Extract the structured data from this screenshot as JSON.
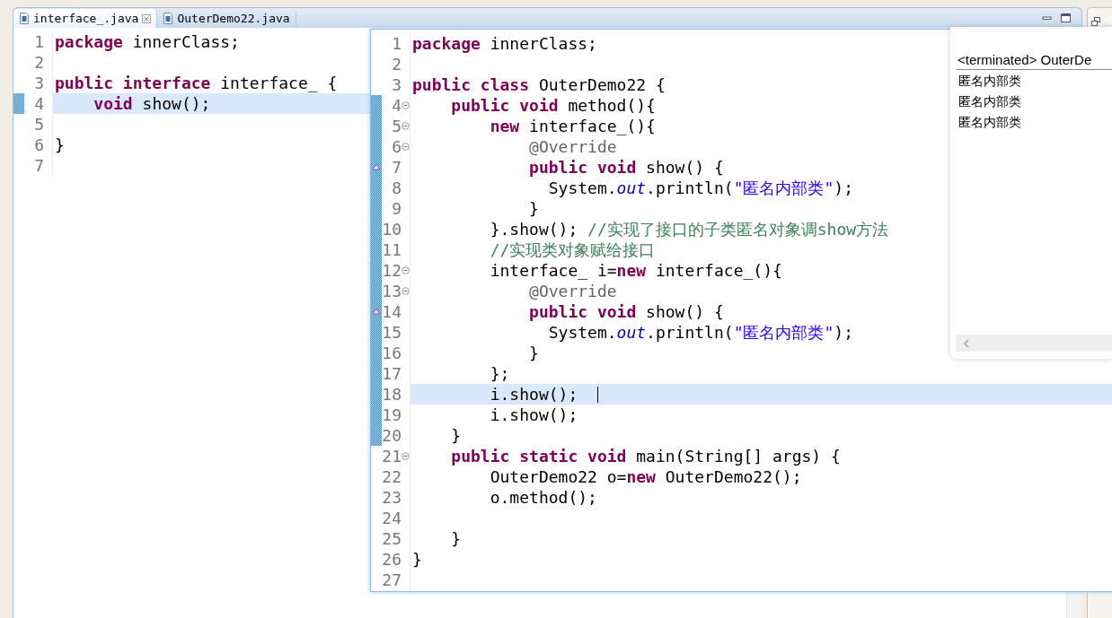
{
  "tabs": [
    {
      "label": "interface_.java",
      "selected": true,
      "closable": true
    },
    {
      "label": "OuterDemo22.java",
      "selected": false,
      "closable": false
    }
  ],
  "editor": {
    "lines": [
      {
        "number": "1",
        "tokens": [
          {
            "kind": "keyword",
            "text": "package"
          },
          {
            "kind": "plain",
            "text": " innerClass;"
          }
        ],
        "current": false,
        "marked": false
      },
      {
        "number": "2",
        "current": false,
        "marked": false
      },
      {
        "number": "3",
        "tokens": [
          {
            "kind": "keyword",
            "text": "public interface"
          },
          {
            "kind": "plain",
            "text": " interface_ {"
          }
        ],
        "current": false,
        "marked": false
      },
      {
        "number": "4",
        "tokens": [
          {
            "kind": "keyword",
            "text": "    void"
          },
          {
            "kind": "plain",
            "text": " show();"
          }
        ],
        "current": true,
        "marked": true
      },
      {
        "number": "5",
        "current": false,
        "marked": false
      },
      {
        "number": "6",
        "tokens": [
          {
            "kind": "plain",
            "text": "}"
          }
        ],
        "current": false,
        "marked": false
      },
      {
        "number": "7",
        "current": false,
        "marked": false
      }
    ]
  },
  "overlay_editor": {
    "lines": [
      {
        "number": "1",
        "tokens": [
          {
            "kind": "keyword",
            "text": "package"
          },
          {
            "kind": "plain",
            "text": " innerClass;"
          }
        ],
        "current": false,
        "marked": false
      },
      {
        "number": "2",
        "current": false,
        "marked": false
      },
      {
        "number": "3",
        "tokens": [
          {
            "kind": "keyword",
            "text": "public class"
          },
          {
            "kind": "plain",
            "text": " OuterDemo22 {"
          }
        ],
        "current": false,
        "marked": false
      },
      {
        "number": "4",
        "tokens": [
          {
            "kind": "keyword",
            "text": "    public void"
          },
          {
            "kind": "plain",
            "text": " method(){"
          }
        ],
        "current": false,
        "marked": true,
        "fold": true
      },
      {
        "number": "5",
        "tokens": [
          {
            "kind": "keyword",
            "text": "        new"
          },
          {
            "kind": "plain",
            "text": " interface_(){"
          }
        ],
        "current": false,
        "marked": true,
        "fold": true
      },
      {
        "number": "6",
        "tokens": [
          {
            "kind": "annotation",
            "text": "            @Override"
          }
        ],
        "current": false,
        "marked": true,
        "fold": true
      },
      {
        "number": "7",
        "tokens": [
          {
            "kind": "keyword",
            "text": "            public void"
          },
          {
            "kind": "plain",
            "text": " show() {"
          }
        ],
        "current": false,
        "marked": true,
        "override": true
      },
      {
        "number": "8",
        "tokens": [
          {
            "kind": "plain",
            "text": "              System."
          },
          {
            "kind": "field",
            "text": "out"
          },
          {
            "kind": "plain",
            "text": ".println("
          },
          {
            "kind": "string",
            "text": "\"匿名内部类\""
          },
          {
            "kind": "plain",
            "text": ");"
          }
        ],
        "current": false,
        "marked": true
      },
      {
        "number": "9",
        "tokens": [
          {
            "kind": "plain",
            "text": "            }"
          }
        ],
        "current": false,
        "marked": true
      },
      {
        "number": "10",
        "tokens": [
          {
            "kind": "plain",
            "text": "        }.show(); "
          },
          {
            "kind": "comment",
            "text": "//实现了接口的子类匿名对象调show方法"
          }
        ],
        "current": false,
        "marked": true
      },
      {
        "number": "11",
        "tokens": [
          {
            "kind": "comment",
            "text": "        //实现类对象赋给接口"
          }
        ],
        "current": false,
        "marked": true
      },
      {
        "number": "12",
        "tokens": [
          {
            "kind": "plain",
            "text": "        interface_ i="
          },
          {
            "kind": "keyword",
            "text": "new"
          },
          {
            "kind": "plain",
            "text": " interface_(){"
          }
        ],
        "current": false,
        "marked": true,
        "fold": true
      },
      {
        "number": "13",
        "tokens": [
          {
            "kind": "annotation",
            "text": "            @Override"
          }
        ],
        "current": false,
        "marked": true,
        "fold": true
      },
      {
        "number": "14",
        "tokens": [
          {
            "kind": "keyword",
            "text": "            public void"
          },
          {
            "kind": "plain",
            "text": " show() {"
          }
        ],
        "current": false,
        "marked": true,
        "override": true
      },
      {
        "number": "15",
        "tokens": [
          {
            "kind": "plain",
            "text": "              System."
          },
          {
            "kind": "field",
            "text": "out"
          },
          {
            "kind": "plain",
            "text": ".println("
          },
          {
            "kind": "string",
            "text": "\"匿名内部类\""
          },
          {
            "kind": "plain",
            "text": ");"
          }
        ],
        "current": false,
        "marked": true
      },
      {
        "number": "16",
        "tokens": [
          {
            "kind": "plain",
            "text": "            }"
          }
        ],
        "current": false,
        "marked": true
      },
      {
        "number": "17",
        "tokens": [
          {
            "kind": "plain",
            "text": "        };"
          }
        ],
        "current": false,
        "marked": true
      },
      {
        "number": "18",
        "tokens": [
          {
            "kind": "plain",
            "text": "        i.show();"
          }
        ],
        "current": true,
        "marked": true,
        "cursor": true
      },
      {
        "number": "19",
        "tokens": [
          {
            "kind": "plain",
            "text": "        i.show();"
          }
        ],
        "current": false,
        "marked": true
      },
      {
        "number": "20",
        "tokens": [
          {
            "kind": "plain",
            "text": "    }"
          }
        ],
        "current": false,
        "marked": true
      },
      {
        "number": "21",
        "tokens": [
          {
            "kind": "keyword",
            "text": "    public static void"
          },
          {
            "kind": "plain",
            "text": " main(String[] args) {"
          }
        ],
        "current": false,
        "marked": false,
        "fold": true
      },
      {
        "number": "22",
        "tokens": [
          {
            "kind": "plain",
            "text": "        OuterDemo22 o="
          },
          {
            "kind": "keyword",
            "text": "new"
          },
          {
            "kind": "plain",
            "text": " OuterDemo22();"
          }
        ],
        "current": false,
        "marked": false
      },
      {
        "number": "23",
        "tokens": [
          {
            "kind": "plain",
            "text": "        o.method();"
          }
        ],
        "current": false,
        "marked": false
      },
      {
        "number": "24",
        "current": false,
        "marked": false
      },
      {
        "number": "25",
        "tokens": [
          {
            "kind": "plain",
            "text": "    }"
          }
        ],
        "current": false,
        "marked": false
      },
      {
        "number": "26",
        "tokens": [
          {
            "kind": "plain",
            "text": "}"
          }
        ],
        "current": false,
        "marked": false
      },
      {
        "number": "27",
        "current": false,
        "marked": false
      }
    ]
  },
  "console": {
    "header": "<terminated> OuterDe",
    "output": [
      "匿名内部类",
      "匿名内部类",
      "匿名内部类"
    ]
  }
}
